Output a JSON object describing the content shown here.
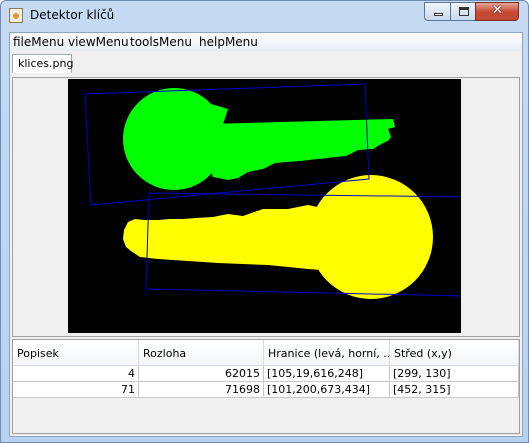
{
  "window": {
    "title": "Detektor klíčů"
  },
  "menu": {
    "items": [
      "fileMenu",
      "viewMenu",
      "toolsMenu",
      "helpMenu"
    ]
  },
  "tabs": [
    {
      "label": "klices.png"
    }
  ],
  "colors": {
    "canvas_background": "#000000",
    "key_green": "#00ff00",
    "key_yellow": "#ffff00",
    "bounding_box": "#0000cc"
  },
  "table": {
    "columns": [
      "Popisek",
      "Rozloha",
      "Hranice (levá, horní, ...",
      "Střed (x,y)"
    ],
    "rows": [
      [
        "4",
        "62015",
        "[105,19,616,248]",
        "[299, 130]"
      ],
      [
        "71",
        "71698",
        "[101,200,673,434]",
        "[452, 315]"
      ]
    ]
  }
}
